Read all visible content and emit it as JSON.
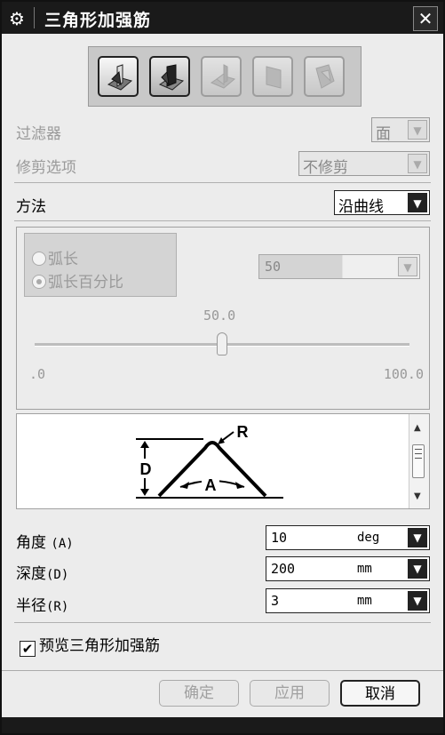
{
  "window": {
    "title": "三角形加强筋",
    "close_label": "✕",
    "settings_icon": "gear-icon"
  },
  "type_buttons": [
    {
      "name": "rib-type-1",
      "icon": "rib-shape-icon",
      "state": "selected"
    },
    {
      "name": "rib-type-2",
      "icon": "rib-shape-icon",
      "state": "pressed"
    },
    {
      "name": "rib-type-3",
      "icon": "rib-shape-icon",
      "state": "disabled"
    },
    {
      "name": "rib-type-4",
      "icon": "rib-shape-icon",
      "state": "disabled"
    },
    {
      "name": "rib-type-5",
      "icon": "rib-shape-icon",
      "state": "disabled"
    }
  ],
  "filter": {
    "label": "过滤器",
    "value": "面"
  },
  "trim": {
    "label": "修剪选项",
    "value": "不修剪"
  },
  "method": {
    "label": "方法",
    "value": "沿曲线"
  },
  "location": {
    "radio_arc_length": "弧长",
    "radio_arc_percent": "弧长百分比",
    "percent_value": "50",
    "slider_value": "50.0",
    "slider_min": ".0",
    "slider_max": "100.0",
    "slider_level": 50
  },
  "diagram": {
    "label_r": "R",
    "label_d": "D",
    "label_a": "A"
  },
  "params": {
    "angle": {
      "label": "角度",
      "code": "(A)",
      "value": "10",
      "unit": "deg"
    },
    "depth": {
      "label": "深度",
      "code": "(D)",
      "value": "200",
      "unit": "mm"
    },
    "radius": {
      "label": "半径",
      "code": "(R)",
      "value": "3",
      "unit": "mm"
    }
  },
  "preview": {
    "label": "预览三角形加强筋",
    "checked": true,
    "check_glyph": "✔"
  },
  "buttons": {
    "ok": "确定",
    "apply": "应用",
    "cancel": "取消"
  },
  "colors": {
    "titlebar": "#1a1a1a",
    "panel": "#ececec",
    "disabled_text": "#9a9a9a"
  }
}
